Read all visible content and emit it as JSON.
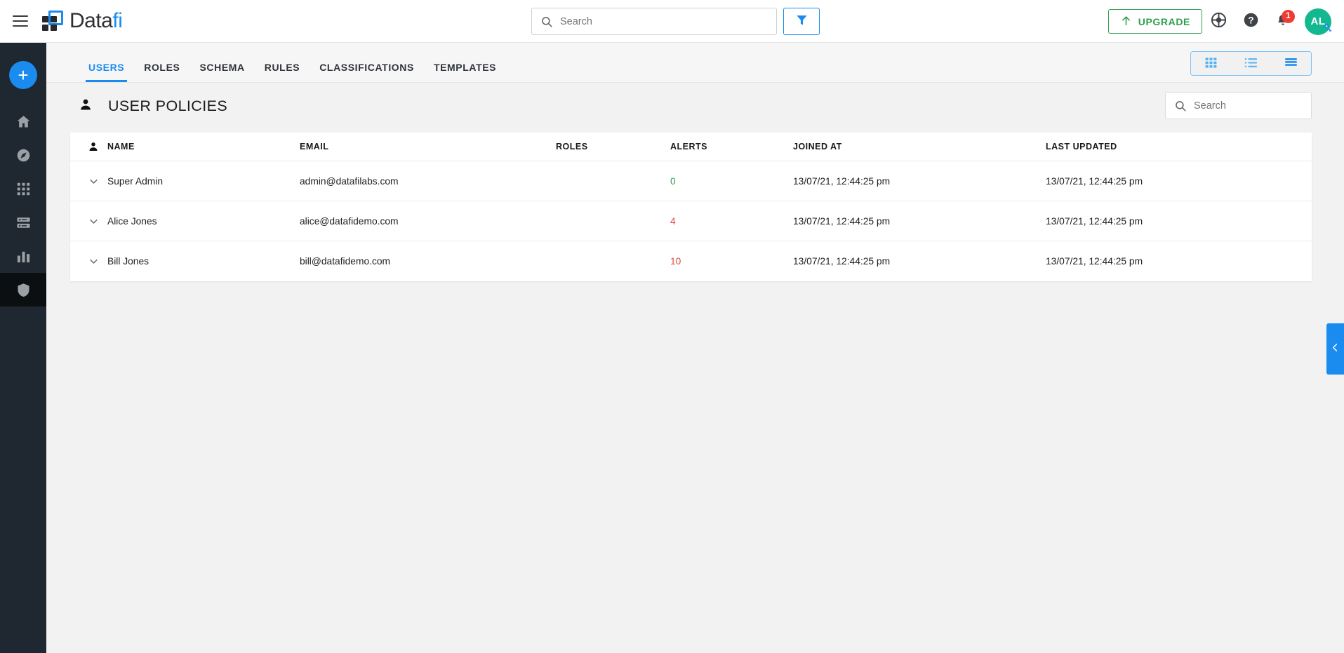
{
  "app": {
    "brand_first": "Data",
    "brand_second": "fi",
    "menu_icon": "hamburger-icon",
    "logo_icon": "datafi-logo-icon"
  },
  "topbar": {
    "search": {
      "placeholder": "Search",
      "value": "",
      "icon": "search-icon"
    },
    "filter_button": {
      "icon": "filter-funnel-icon",
      "label": ""
    },
    "upgrade_button": {
      "label": "UPGRADE",
      "icon": "arrow-up-icon",
      "color": "#2f9e4f"
    },
    "support_icon": "lifebuoy-icon",
    "help_icon": "help-circle-icon",
    "notifications": {
      "icon": "bell-icon",
      "badge": "1",
      "badge_color": "#ef3b31"
    },
    "avatar": {
      "initials": "AL",
      "color": "#12b890",
      "badge_icon": "key-icon"
    }
  },
  "sidebar": {
    "add_button": {
      "label": "+",
      "color": "#1a8cf0"
    },
    "items": [
      {
        "icon": "home-icon",
        "name": "home",
        "active": false
      },
      {
        "icon": "compass-explore-icon",
        "name": "explore",
        "active": false
      },
      {
        "icon": "apps-grid-icon",
        "name": "apps",
        "active": false
      },
      {
        "icon": "database-storage-icon",
        "name": "storage",
        "active": false
      },
      {
        "icon": "bar-chart-icon",
        "name": "analytics",
        "active": false
      },
      {
        "icon": "shield-icon",
        "name": "security",
        "active": true
      }
    ]
  },
  "tabs": [
    {
      "label": "USERS",
      "active": true
    },
    {
      "label": "ROLES",
      "active": false
    },
    {
      "label": "SCHEMA",
      "active": false
    },
    {
      "label": "RULES",
      "active": false
    },
    {
      "label": "CLASSIFICATIONS",
      "active": false
    },
    {
      "label": "TEMPLATES",
      "active": false
    }
  ],
  "view_toggle": [
    {
      "name": "grid-view",
      "icon": "grid-view-icon",
      "selected": false
    },
    {
      "name": "list-view",
      "icon": "list-view-icon",
      "selected": false
    },
    {
      "name": "table-view",
      "icon": "table-view-icon",
      "selected": true
    }
  ],
  "page": {
    "title": "USER POLICIES",
    "title_icon": "person-icon",
    "search": {
      "placeholder": "Search",
      "value": "",
      "icon": "search-icon"
    }
  },
  "table": {
    "columns": {
      "name": "NAME",
      "email": "EMAIL",
      "roles": "ROLES",
      "alerts": "ALERTS",
      "joined": "JOINED AT",
      "updated": "LAST UPDATED"
    },
    "rows": [
      {
        "name": "Super Admin",
        "email": "admin@datafilabs.com",
        "roles": "",
        "alerts": "0",
        "alerts_state": "ok",
        "joined": "13/07/21, 12:44:25 pm",
        "updated": "13/07/21, 12:44:25 pm"
      },
      {
        "name": "Alice Jones",
        "email": "alice@datafidemo.com",
        "roles": "",
        "alerts": "4",
        "alerts_state": "alert",
        "joined": "13/07/21, 12:44:25 pm",
        "updated": "13/07/21, 12:44:25 pm"
      },
      {
        "name": "Bill Jones",
        "email": "bill@datafidemo.com",
        "roles": "",
        "alerts": "10",
        "alerts_state": "alert",
        "joined": "13/07/21, 12:44:25 pm",
        "updated": "13/07/21, 12:44:25 pm"
      }
    ]
  },
  "edge_panel": {
    "icon": "chevron-left-icon",
    "color": "#1a8cf0"
  },
  "colors": {
    "accent": "#1a8cf0",
    "success": "#2f9e4f",
    "danger": "#e4483c",
    "rail": "#1f2730",
    "page_bg": "#f2f2f2"
  }
}
